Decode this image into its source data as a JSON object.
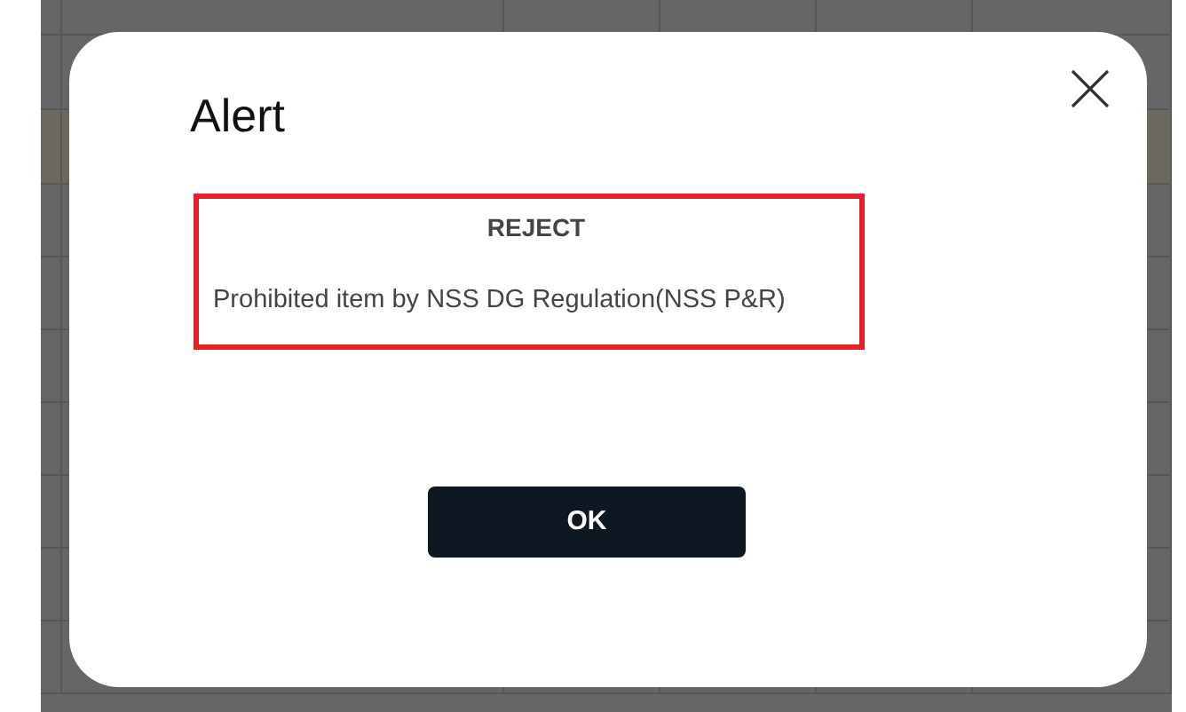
{
  "dialog": {
    "title": "Alert",
    "message": {
      "heading": "REJECT",
      "text": "Prohibited item by NSS DG Regulation(NSS P&R)"
    },
    "buttons": [
      "OK"
    ]
  }
}
